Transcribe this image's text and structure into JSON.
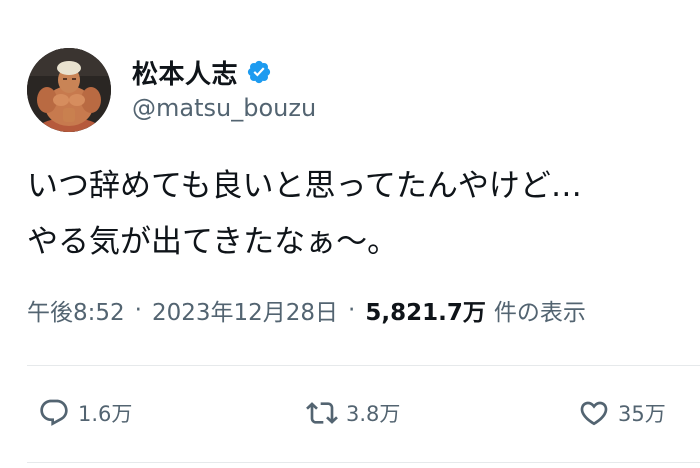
{
  "user": {
    "display_name": "松本人志",
    "handle": "@matsu_bouzu",
    "verified_icon": "verified-badge-icon",
    "badge_color": "#1d9bf0"
  },
  "tweet": {
    "text": "いつ辞めても良いと思ってたんやけど…\nやる気が出てきたなぁ〜。"
  },
  "meta": {
    "time": "午後8:52",
    "separator": "·",
    "date": "2023年12月28日",
    "views_count": "5,821.7万",
    "views_label": "件の表示"
  },
  "actions": {
    "reply": {
      "icon": "reply-icon",
      "count": "1.6万"
    },
    "retweet": {
      "icon": "retweet-icon",
      "count": "3.8万"
    },
    "like": {
      "icon": "heart-icon",
      "count": "35万"
    }
  }
}
